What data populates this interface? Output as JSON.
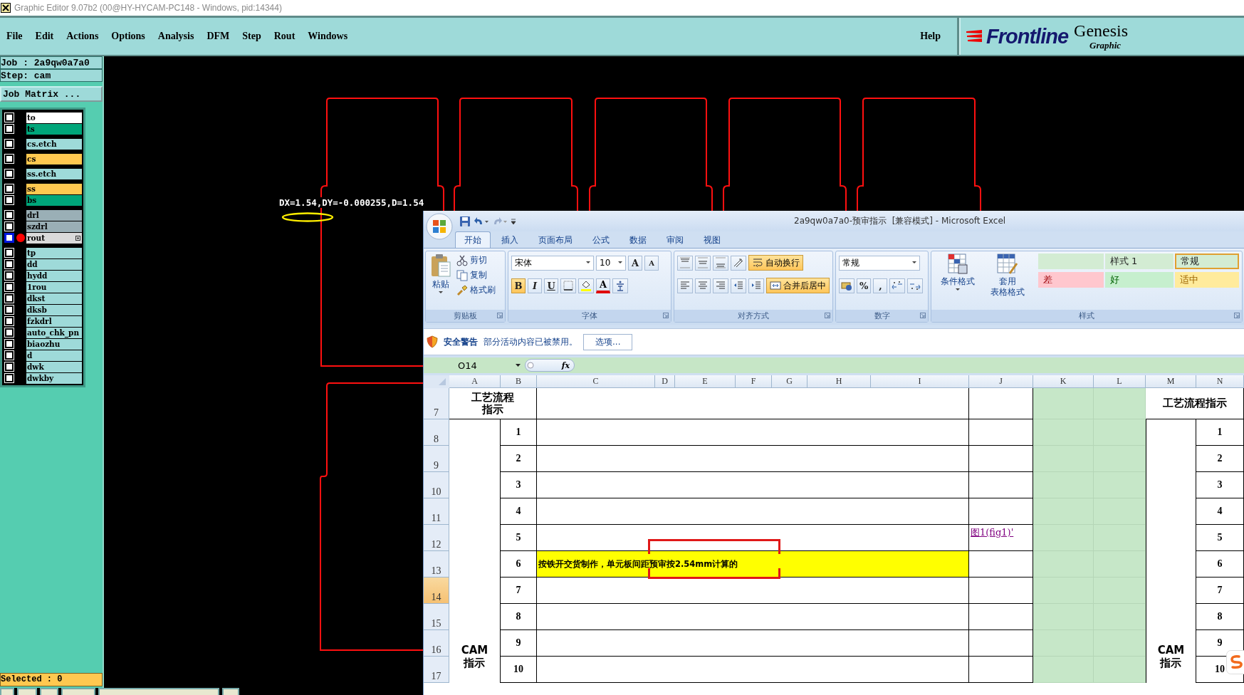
{
  "title_bar": {
    "title": "Graphic Editor 9.07b2 (00@HY-HYCAM-PC148 - Windows, pid:14344)"
  },
  "menu_bar": {
    "items": [
      "File",
      "Edit",
      "Actions",
      "Options",
      "Analysis",
      "DFM",
      "Step",
      "Rout",
      "Windows"
    ],
    "help": "Help"
  },
  "logo": {
    "brand": "Frontline",
    "product": "Genesis",
    "subtitle": "Graphic"
  },
  "job_panel": {
    "job": "Job : 2a9qw0a7a0",
    "step": "Step: cam",
    "matrix_button": "Job Matrix ...",
    "layer_groups": [
      {
        "layers": [
          {
            "name": "to",
            "color": "#ffffff",
            "work": false,
            "checked": false
          },
          {
            "name": "ts",
            "color": "#00a67a",
            "work": false,
            "checked": false
          }
        ]
      },
      {
        "layers": [
          {
            "name": "cs.etch",
            "color": "#9edad9",
            "work": false,
            "checked": false
          }
        ]
      },
      {
        "layers": [
          {
            "name": "cs",
            "color": "#ffc850",
            "work": false,
            "checked": false
          }
        ]
      },
      {
        "layers": [
          {
            "name": "ss.etch",
            "color": "#9edad9",
            "work": false,
            "checked": false
          }
        ]
      },
      {
        "layers": [
          {
            "name": "ss",
            "color": "#ffc850",
            "work": false,
            "checked": false
          },
          {
            "name": "bs",
            "color": "#00a67a",
            "work": false,
            "checked": false
          }
        ]
      },
      {
        "layers": [
          {
            "name": "drl",
            "color": "#9aafb6",
            "work": false,
            "checked": false
          },
          {
            "name": "szdrl",
            "color": "#9aafb6",
            "work": false,
            "checked": false
          },
          {
            "name": "rout",
            "color": "#dadada",
            "work": true,
            "checked": false
          }
        ]
      },
      {
        "layers": [
          {
            "name": "tp",
            "color": "#9edad9",
            "work": false,
            "checked": false
          },
          {
            "name": "dd",
            "color": "#9edad9",
            "work": false,
            "checked": false
          },
          {
            "name": "hydd",
            "color": "#9edad9",
            "work": false,
            "checked": false
          },
          {
            "name": "1rou",
            "color": "#9edad9",
            "work": false,
            "checked": false
          },
          {
            "name": "dkst",
            "color": "#9edad9",
            "work": false,
            "checked": false
          },
          {
            "name": "dksb",
            "color": "#9edad9",
            "work": false,
            "checked": false
          },
          {
            "name": "fzkdrl",
            "color": "#9edad9",
            "work": false,
            "checked": false
          },
          {
            "name": "auto_chk_pn",
            "color": "#9edad9",
            "work": false,
            "checked": false
          },
          {
            "name": "biaozhu",
            "color": "#9edad9",
            "work": false,
            "checked": false
          },
          {
            "name": "d",
            "color": "#9edad9",
            "work": false,
            "checked": false
          },
          {
            "name": "dwk",
            "color": "#9edad9",
            "work": false,
            "checked": false
          },
          {
            "name": "dwkby",
            "color": "#9edad9",
            "work": false,
            "checked": false
          }
        ]
      }
    ],
    "selected": "Selected : 0"
  },
  "canvas": {
    "measurement": "DX=1.54,DY=-0.000255,D=1.54"
  },
  "excel": {
    "title": "2a9qw0a7a0-预审指示  [兼容模式] - Microsoft Excel",
    "tabs": [
      {
        "label": "开始",
        "selected": true
      },
      {
        "label": "插入",
        "selected": false
      },
      {
        "label": "页面布局",
        "selected": false
      },
      {
        "label": "公式",
        "selected": false
      },
      {
        "label": "数据",
        "selected": false
      },
      {
        "label": "审阅",
        "selected": false
      },
      {
        "label": "视图",
        "selected": false
      }
    ],
    "ribbon": {
      "clipboard": {
        "paste": "粘贴",
        "cut": "剪切",
        "copy": "复制",
        "format_painter": "格式刷",
        "label": "剪贴板"
      },
      "font": {
        "name": "宋体",
        "size": "10",
        "grow": "A",
        "shrink": "A",
        "bold": "B",
        "italic": "I",
        "underline": "U",
        "font_color": "A",
        "label": "字体"
      },
      "alignment": {
        "wrap": "自动换行",
        "merge": "合并后居中",
        "label": "对齐方式"
      },
      "number": {
        "format": "常规",
        "percent": "%",
        "comma": ",",
        "label": "数字"
      },
      "styles": {
        "conditional": "条件格式",
        "table_format": [
          "套用",
          "表格格式"
        ],
        "label": "样式",
        "cells": [
          {
            "kind": "swatch",
            "color": "#d3ecd3",
            "selected": false
          },
          {
            "kind": "text",
            "text": "样式 1",
            "color": "#d3ecd3",
            "selected": false
          },
          {
            "kind": "text",
            "text": "常规",
            "color": "#d3ecd3",
            "selected": true
          },
          {
            "kind": "text",
            "text": "差",
            "color": "#ffc7ce",
            "selected": false
          },
          {
            "kind": "text",
            "text": "好",
            "color": "#c6efce",
            "selected": false
          },
          {
            "kind": "text",
            "text": "适中",
            "color": "#ffeb9c",
            "selected": false
          }
        ]
      }
    },
    "security_bar": {
      "title": "安全警告",
      "message": "部分活动内容已被禁用。",
      "button": "选项..."
    },
    "formula_bar": {
      "name_box": "O14",
      "function_label": "fx"
    },
    "columns": [
      "A",
      "B",
      "C",
      "D",
      "E",
      "F",
      "G",
      "H",
      "I",
      "J",
      "K",
      "L",
      "M",
      "N"
    ],
    "rows": [
      {
        "header": "7",
        "selected": false,
        "kind": "title",
        "left_title": [
          "工艺流程",
          "指示"
        ],
        "right_title": "工艺流程指示"
      },
      {
        "header": "8",
        "selected": false,
        "kind": "step",
        "step": "1",
        "right_step": "1",
        "highlight": false
      },
      {
        "header": "9",
        "selected": false,
        "kind": "step",
        "step": "2",
        "right_step": "2",
        "highlight": false
      },
      {
        "header": "10",
        "selected": false,
        "kind": "step",
        "step": "3",
        "right_step": "3",
        "highlight": false
      },
      {
        "header": "11",
        "selected": false,
        "kind": "step",
        "step": "4",
        "right_step": "4",
        "highlight": false
      },
      {
        "header": "12",
        "selected": false,
        "kind": "step",
        "step": "5",
        "right_step": "5",
        "highlight": false,
        "link": "图1(fig1)'"
      },
      {
        "header": "13",
        "selected": false,
        "kind": "step",
        "step": "6",
        "right_step": "6",
        "highlight": true,
        "instruction": "按铁开交货制作，单元板间距预审按2.54mm计算的"
      },
      {
        "header": "14",
        "selected": true,
        "kind": "step",
        "step": "7",
        "right_step": "7",
        "highlight": false
      },
      {
        "header": "15",
        "selected": false,
        "kind": "step",
        "step": "8",
        "right_step": "8",
        "highlight": false
      },
      {
        "header": "16",
        "selected": false,
        "kind": "step",
        "step": "9",
        "right_step": "9",
        "highlight": false
      },
      {
        "header": "17",
        "selected": false,
        "kind": "step",
        "step": "10",
        "right_step": "10",
        "highlight": false
      }
    ],
    "side_label": {
      "left": [
        "CAM",
        "指示"
      ],
      "right": [
        "CAM",
        "指示"
      ]
    }
  }
}
